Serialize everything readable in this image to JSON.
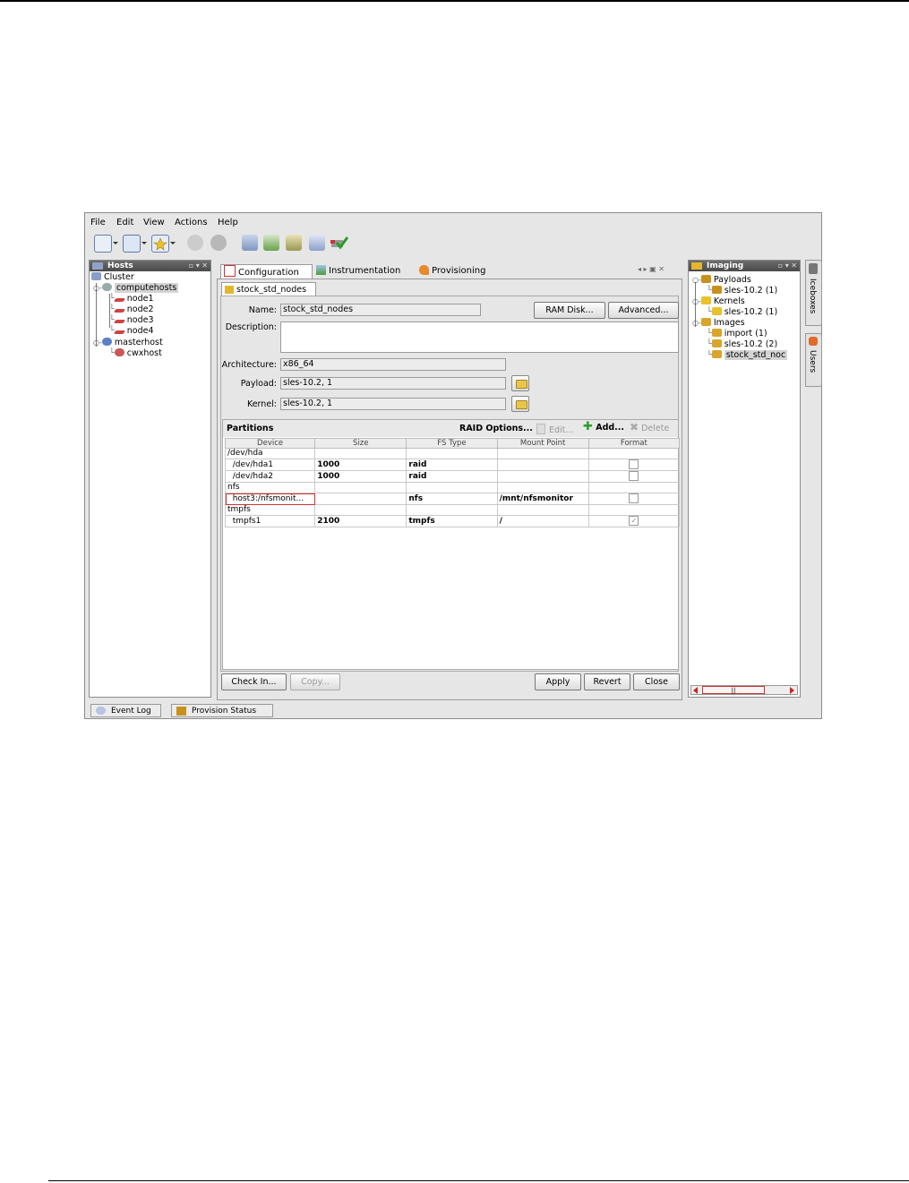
{
  "menu": [
    "File",
    "Edit",
    "View",
    "Actions",
    "Help"
  ],
  "toolbar": {
    "icons": [
      "new-window-icon",
      "layout-icon",
      "favorites-icon",
      "power-icon",
      "stop-icon",
      "database-icon",
      "refresh-icon",
      "upload-icon",
      "inspect-icon",
      "check-icon"
    ]
  },
  "hosts": {
    "title": "Hosts",
    "root": "Cluster",
    "computehosts": "computehosts",
    "nodes": [
      "node1",
      "node2",
      "node3",
      "node4"
    ],
    "masterhost": "masterhost",
    "cwxhost": "cwxhost"
  },
  "tabs": {
    "configuration": "Configuration",
    "instrumentation": "Instrumentation",
    "provisioning": "Provisioning",
    "subtab": "stock_std_nodes"
  },
  "form": {
    "name_label": "Name:",
    "name_value": "stock_std_nodes",
    "ramdisk_button": "RAM Disk...",
    "advanced_button": "Advanced...",
    "description_label": "Description:",
    "description_value": "",
    "architecture_label": "Architecture:",
    "architecture_value": "x86_64",
    "payload_label": "Payload:",
    "payload_value": "sles-10.2, 1",
    "kernel_label": "Kernel:",
    "kernel_value": "sles-10.2, 1"
  },
  "partitions": {
    "title": "Partitions",
    "raid_options": "RAID Options...",
    "edit": "Edit...",
    "add": "Add...",
    "delete": "Delete",
    "columns": [
      "Device",
      "Size",
      "FS Type",
      "Mount Point",
      "Format"
    ],
    "rows": [
      {
        "device": "/dev/hda",
        "size": "",
        "fstype": "",
        "mount": "",
        "format": null
      },
      {
        "device": "  /dev/hda1",
        "size": "1000",
        "fstype": "raid",
        "mount": "",
        "format": false
      },
      {
        "device": "  /dev/hda2",
        "size": "1000",
        "fstype": "raid",
        "mount": "",
        "format": false
      },
      {
        "device": "nfs",
        "size": "",
        "fstype": "",
        "mount": "",
        "format": null
      },
      {
        "device": "  host3:/nfsmonit...",
        "size": "",
        "fstype": "nfs",
        "mount": "/mnt/nfsmonitor",
        "format": false
      },
      {
        "device": "tmpfs",
        "size": "",
        "fstype": "",
        "mount": "",
        "format": null
      },
      {
        "device": "  tmpfs1",
        "size": "2100",
        "fstype": "tmpfs",
        "mount": "/",
        "format": true
      }
    ]
  },
  "actions": {
    "check_in": "Check In...",
    "copy": "Copy...",
    "apply": "Apply",
    "revert": "Revert",
    "close": "Close"
  },
  "imaging": {
    "title": "Imaging",
    "payloads": "Payloads",
    "payload_item": "sles-10.2 (1)",
    "kernels": "Kernels",
    "kernel_item": "sles-10.2 (1)",
    "images": "Images",
    "image_items": [
      "import (1)",
      "sles-10.2 (2)",
      "stock_std_noc"
    ]
  },
  "side_tabs": [
    "Iceboxes",
    "Users"
  ],
  "bottom_tabs": [
    "Event Log",
    "Provision Status"
  ],
  "colors": {
    "selection": "#d4d4d4",
    "highlight_border": "#cc3333",
    "title_bar": "#5a5a5a"
  }
}
